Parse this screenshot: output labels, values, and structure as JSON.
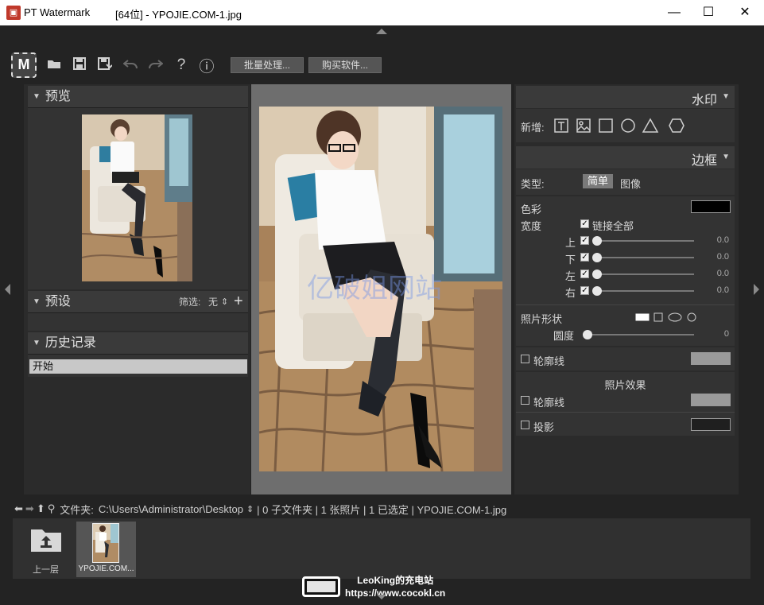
{
  "titlebar": {
    "app_name": "PT Watermark",
    "doc_title": "[64位] - YPOJIE.COM-1.jpg",
    "minimize": "—",
    "maximize": "☐",
    "close": "✕"
  },
  "toolbar": {
    "logo": "M",
    "icons": [
      "folder-open-icon",
      "save-icon",
      "save-as-icon",
      "undo-icon",
      "redo-icon",
      "help-icon",
      "info-icon"
    ],
    "help_glyph": "?",
    "info_glyph": "ⓘ",
    "batch_label": "批量处理...",
    "buy_label": "购买软件..."
  },
  "left": {
    "preview_title": "预览",
    "presets_title": "预设",
    "filter_label": "筛选:",
    "filter_value": "无",
    "filter_arrows": "⇕",
    "add_glyph": "+",
    "history_title": "历史记录",
    "history_items": [
      "开始"
    ]
  },
  "right": {
    "watermark_title": "水印",
    "add_label": "新增:",
    "border_title": "边框",
    "type_label": "类型:",
    "type_simple": "简单",
    "type_image": "图像",
    "color_label": "色彩",
    "color_value": "#000000",
    "width_label": "宽度",
    "link_all_label": "链接全部",
    "sides": [
      {
        "label": "上",
        "value": "0.0"
      },
      {
        "label": "下",
        "value": "0.0"
      },
      {
        "label": "左",
        "value": "0.0"
      },
      {
        "label": "右",
        "value": "0.0"
      }
    ],
    "photo_shape_label": "照片形状",
    "roundness_label": "圆度",
    "roundness_value": "0",
    "outline_label": "轮廓线",
    "outline_color": "#9a9a9a",
    "effects_title": "照片效果",
    "effect_outline_label": "轮廓线",
    "effect_outline_color": "#9a9a9a",
    "shadow_label": "投影",
    "shadow_color": "#1f1f1f"
  },
  "center": {
    "watermark_text": "亿破姐网站"
  },
  "pathbar": {
    "folder_label": "文件夹:",
    "path": "C:\\Users\\Administrator\\Desktop",
    "path_arrows": "⇕",
    "info": "| 0 子文件夹 | 1 张照片 | 1 已选定 | YPOJIE.COM-1.jpg"
  },
  "filmstrip": {
    "up_label": "上一层",
    "file_label": "YPOJIE.COM..."
  },
  "overlay": {
    "line1": "LeoKing的充电站",
    "line2": "https://www.cocokl.cn"
  }
}
